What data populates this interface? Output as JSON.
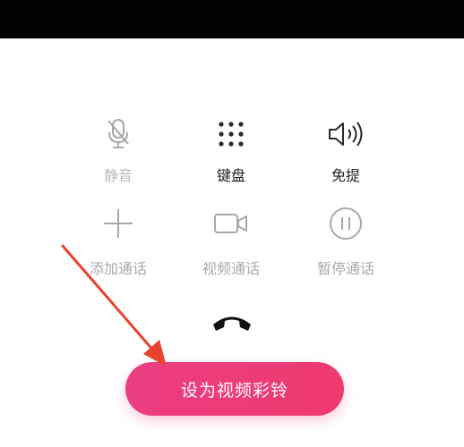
{
  "controls": [
    {
      "label": "静音",
      "icon": "mic-off-icon",
      "state": "disabled"
    },
    {
      "label": "键盘",
      "icon": "keypad-icon",
      "state": "enabled"
    },
    {
      "label": "免提",
      "icon": "speaker-icon",
      "state": "enabled"
    },
    {
      "label": "添加通话",
      "icon": "plus-icon",
      "state": "disabled"
    },
    {
      "label": "视频通话",
      "icon": "video-camera-icon",
      "state": "disabled"
    },
    {
      "label": "暂停通话",
      "icon": "pause-icon",
      "state": "disabled"
    }
  ],
  "hangup": {
    "icon": "hang-up-icon"
  },
  "video_ringtone_button": {
    "label": "设为视频彩铃"
  },
  "colors": {
    "top_bar": "#000000",
    "accent": "#ec3d83",
    "arrow": "#e8432f",
    "disabled_text": "#b9b9b9",
    "enabled_text": "#222222"
  }
}
